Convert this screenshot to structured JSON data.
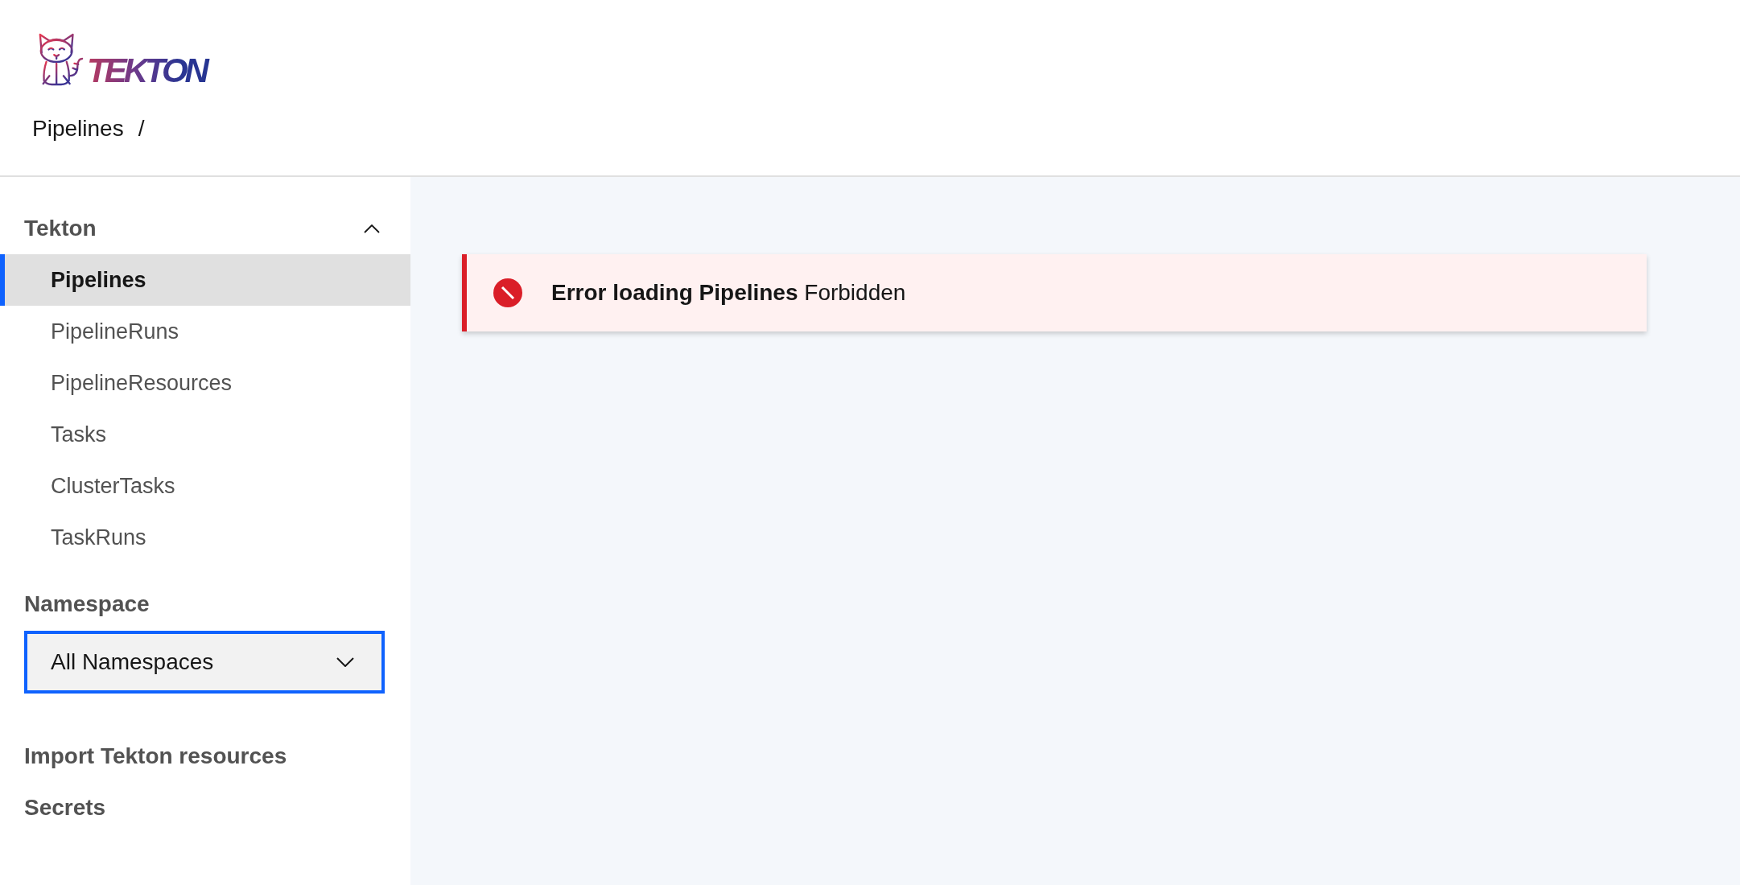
{
  "header": {
    "logo": {
      "wordmark": "TEKTON"
    },
    "breadcrumb": [
      {
        "label": "Pipelines",
        "separator": "/"
      }
    ]
  },
  "sidebar": {
    "sections": [
      {
        "kind": "group",
        "title": "Tekton",
        "expanded": true,
        "items": [
          {
            "label": "Pipelines",
            "selected": true
          },
          {
            "label": "PipelineRuns",
            "selected": false
          },
          {
            "label": "PipelineResources",
            "selected": false
          },
          {
            "label": "Tasks",
            "selected": false
          },
          {
            "label": "ClusterTasks",
            "selected": false
          },
          {
            "label": "TaskRuns",
            "selected": false
          }
        ]
      },
      {
        "kind": "select",
        "title": "Namespace",
        "value": "All Namespaces",
        "focused": true
      },
      {
        "kind": "link",
        "label": "Import Tekton resources"
      },
      {
        "kind": "link",
        "label": "Secrets"
      }
    ]
  },
  "main": {
    "notification": {
      "kind": "error",
      "title": "Error loading Pipelines",
      "message": "Forbidden"
    }
  }
}
